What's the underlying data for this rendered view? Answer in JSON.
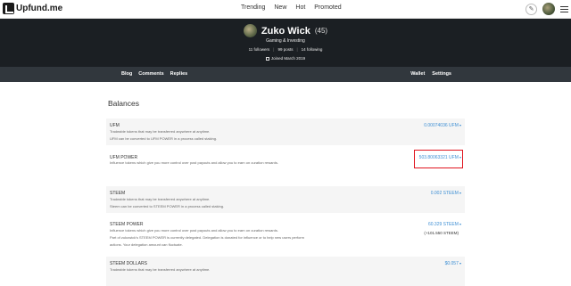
{
  "site": {
    "logo_text": "Upfund.me"
  },
  "topnav": {
    "items": [
      "Trending",
      "New",
      "Hot",
      "Promoted"
    ]
  },
  "profile": {
    "name": "Zuko Wick",
    "reputation": "(45)",
    "about": "Gaming & Investing",
    "followers": "11 followers",
    "posts": "99 posts",
    "following": "14 following",
    "joined": "Joined March 2019"
  },
  "subnav": {
    "left": [
      "Blog",
      "Comments",
      "Replies"
    ],
    "right": [
      "Wallet",
      "Settings"
    ]
  },
  "balances": {
    "title": "Balances",
    "rows": [
      {
        "title": "UFM",
        "desc1": "Tradeable tokens that may be transferred anywhere at anytime.",
        "desc2": "UFM can be converted to UFM POWER in a process called staking.",
        "value": "0.00074036 UFM"
      },
      {
        "title": "UFM POWER",
        "desc1": "Influence tokens which give you more control over post payouts and allow you to earn on curation rewards.",
        "value": "503.80063321 UFM"
      },
      {
        "title": "STEEM",
        "desc1": "Tradeable tokens that may be transferred anywhere at anytime.",
        "desc2": "Steem can be converted to STEEM POWER in a process called staking.",
        "value": "0.002 STEEM"
      },
      {
        "title": "STEEM POWER",
        "desc1": "Influence tokens which give you more control over post payouts and allow you to earn on curation rewards.",
        "desc2": "Part of zukowick's STEEM POWER is currently delegated. Delegation is donated for influence or to help new users perform",
        "desc3": "actions. Your delegation amount can fluctuate.",
        "value": "60.329 STEEM",
        "sub": "(+101.550 STEEM)"
      },
      {
        "title": "STEEM DOLLARS",
        "desc1": "Tradeable tokens that may be transferred anywhere at anytime.",
        "value": "$0.057"
      }
    ]
  },
  "colors": {
    "accent": "#3e8fd4",
    "highlight": "#e0141e",
    "header_bg": "#1b1f23",
    "subnav_bg": "#31373d"
  }
}
